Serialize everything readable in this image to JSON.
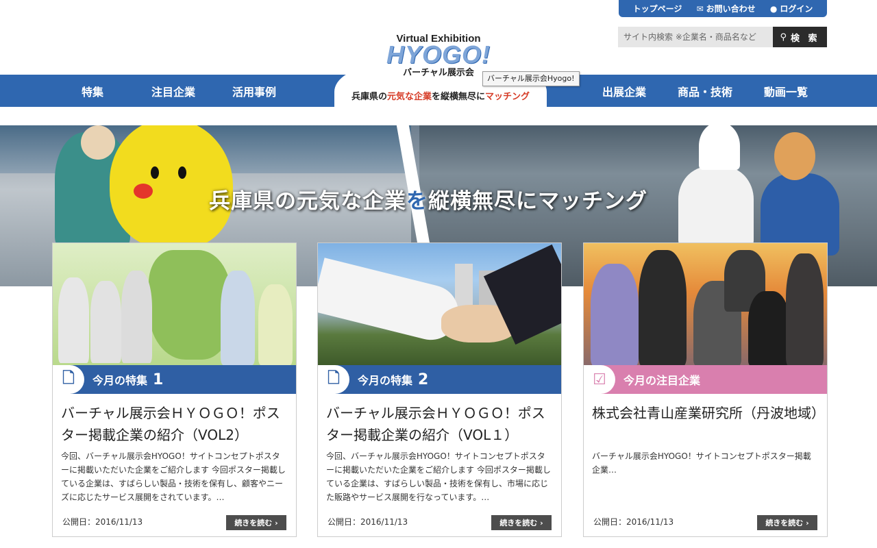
{
  "topbar": {
    "home": "トップページ",
    "contact": "お問い合わせ",
    "login": "ログイン"
  },
  "search": {
    "placeholder": "サイト内検索 ※企業名・商品名など",
    "button": "検 索"
  },
  "logo": {
    "line1": "Virtual Exhibition",
    "line2": "HYOGO!",
    "line3": "バーチャル展示会"
  },
  "tooltip": "バーチャル展示会Hyogo!",
  "tagline": {
    "part1": "兵庫県の",
    "part2": "元気な企業",
    "part3": "を縦横無尽に",
    "part4": "マッチング"
  },
  "nav": {
    "left": [
      "特集",
      "注目企業",
      "活用事例"
    ],
    "right": [
      "出展企業",
      "商品・技術",
      "動画一覧"
    ]
  },
  "hero": {
    "text1": "兵庫県の元気な企業",
    "text2": "を",
    "text3": "縦横無尽にマッチング"
  },
  "cards": [
    {
      "band": "今月の特集",
      "num": "1",
      "icon": "document-icon",
      "title": "バーチャル展示会ＨＹＯＧＯ！ポスター掲載企業の紹介（VOL2）",
      "desc": "今回、バーチャル展示会HYOGO！サイトコンセプトポスターに掲載いただいた企業をご紹介します 今回ポスター掲載している企業は、すばらしい製品・技術を保有し、顧客やニーズに応じたサービス展開をされています。…",
      "date": "公開日：2016/11/13",
      "more": "続きを読む ›"
    },
    {
      "band": "今月の特集",
      "num": "2",
      "icon": "document-icon",
      "title": "バーチャル展示会ＨＹＯＧＯ！ポスター掲載企業の紹介（VOL１）",
      "desc": "今回、バーチャル展示会HYOGO！サイトコンセプトポスターに掲載いただいた企業をご紹介します 今回ポスター掲載している企業は、すばらしい製品・技術を保有し、市場に応じた販路やサービス展開を行なっています。…",
      "date": "公開日：2016/11/13",
      "more": "続きを読む ›"
    },
    {
      "band": "今月の注目企業",
      "num": "",
      "icon": "checkbox-icon",
      "title": "株式会社青山産業研究所（丹波地域）",
      "desc": "バーチャル展示会HYOGO！サイトコンセプトポスター掲載企業…",
      "date": "公開日：2016/11/13",
      "more": "続きを読む ›"
    }
  ]
}
